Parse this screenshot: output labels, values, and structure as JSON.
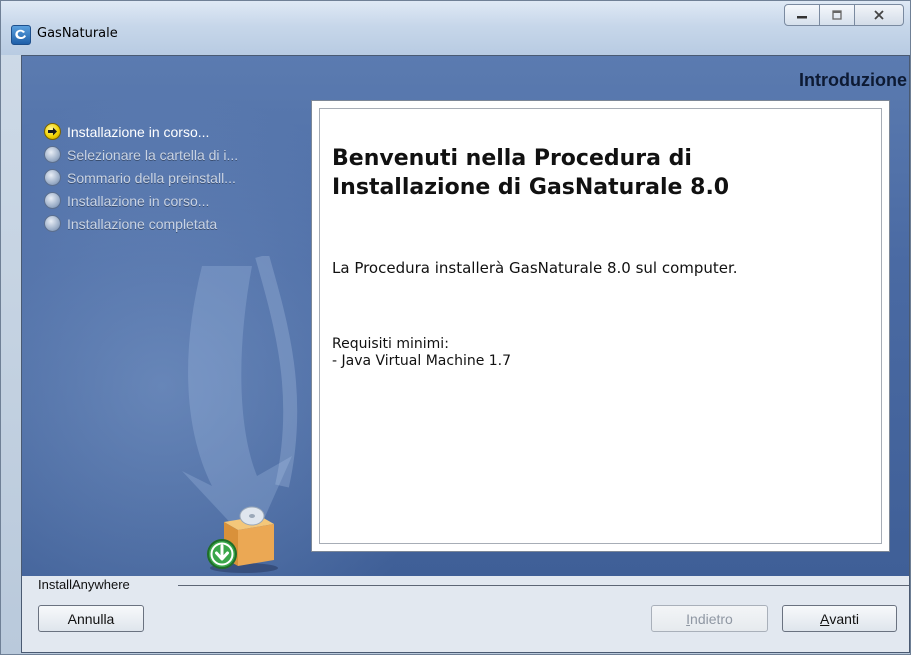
{
  "window": {
    "title": "GasNaturale"
  },
  "header": {
    "title": "Introduzione"
  },
  "steps": [
    {
      "label": "Installazione in corso...",
      "state": "active"
    },
    {
      "label": "Selezionare la cartella di i...",
      "state": "inactive"
    },
    {
      "label": "Sommario della preinstall...",
      "state": "inactive"
    },
    {
      "label": "Installazione in corso...",
      "state": "inactive"
    },
    {
      "label": "Installazione completata",
      "state": "inactive"
    }
  ],
  "content": {
    "heading_line1": "Benvenuti nella Procedura di",
    "heading_line2": "Installazione di GasNaturale 8.0",
    "description": "La Procedura installerà GasNaturale 8.0 sul computer.",
    "requirements_title": "Requisiti minimi:",
    "requirements_item": "- Java Virtual Machine 1.7"
  },
  "footer": {
    "brand": "InstallAnywhere",
    "cancel_label": "Annulla",
    "back_label": "Indietro",
    "back_mnemonic": "I",
    "back_rest": "ndietro",
    "next_mnemonic": "A",
    "next_rest": "vanti"
  },
  "icons": [
    "app-icon",
    "minimize-icon",
    "maximize-icon",
    "close-icon",
    "step-active-arrow-icon",
    "step-inactive-bullet-icon",
    "install-box-icon",
    "download-arrow-icon"
  ],
  "colors": {
    "panel_blue": "#4a6aa3",
    "active_bullet": "#f3d400",
    "title_bar": "#c7d7ea"
  }
}
